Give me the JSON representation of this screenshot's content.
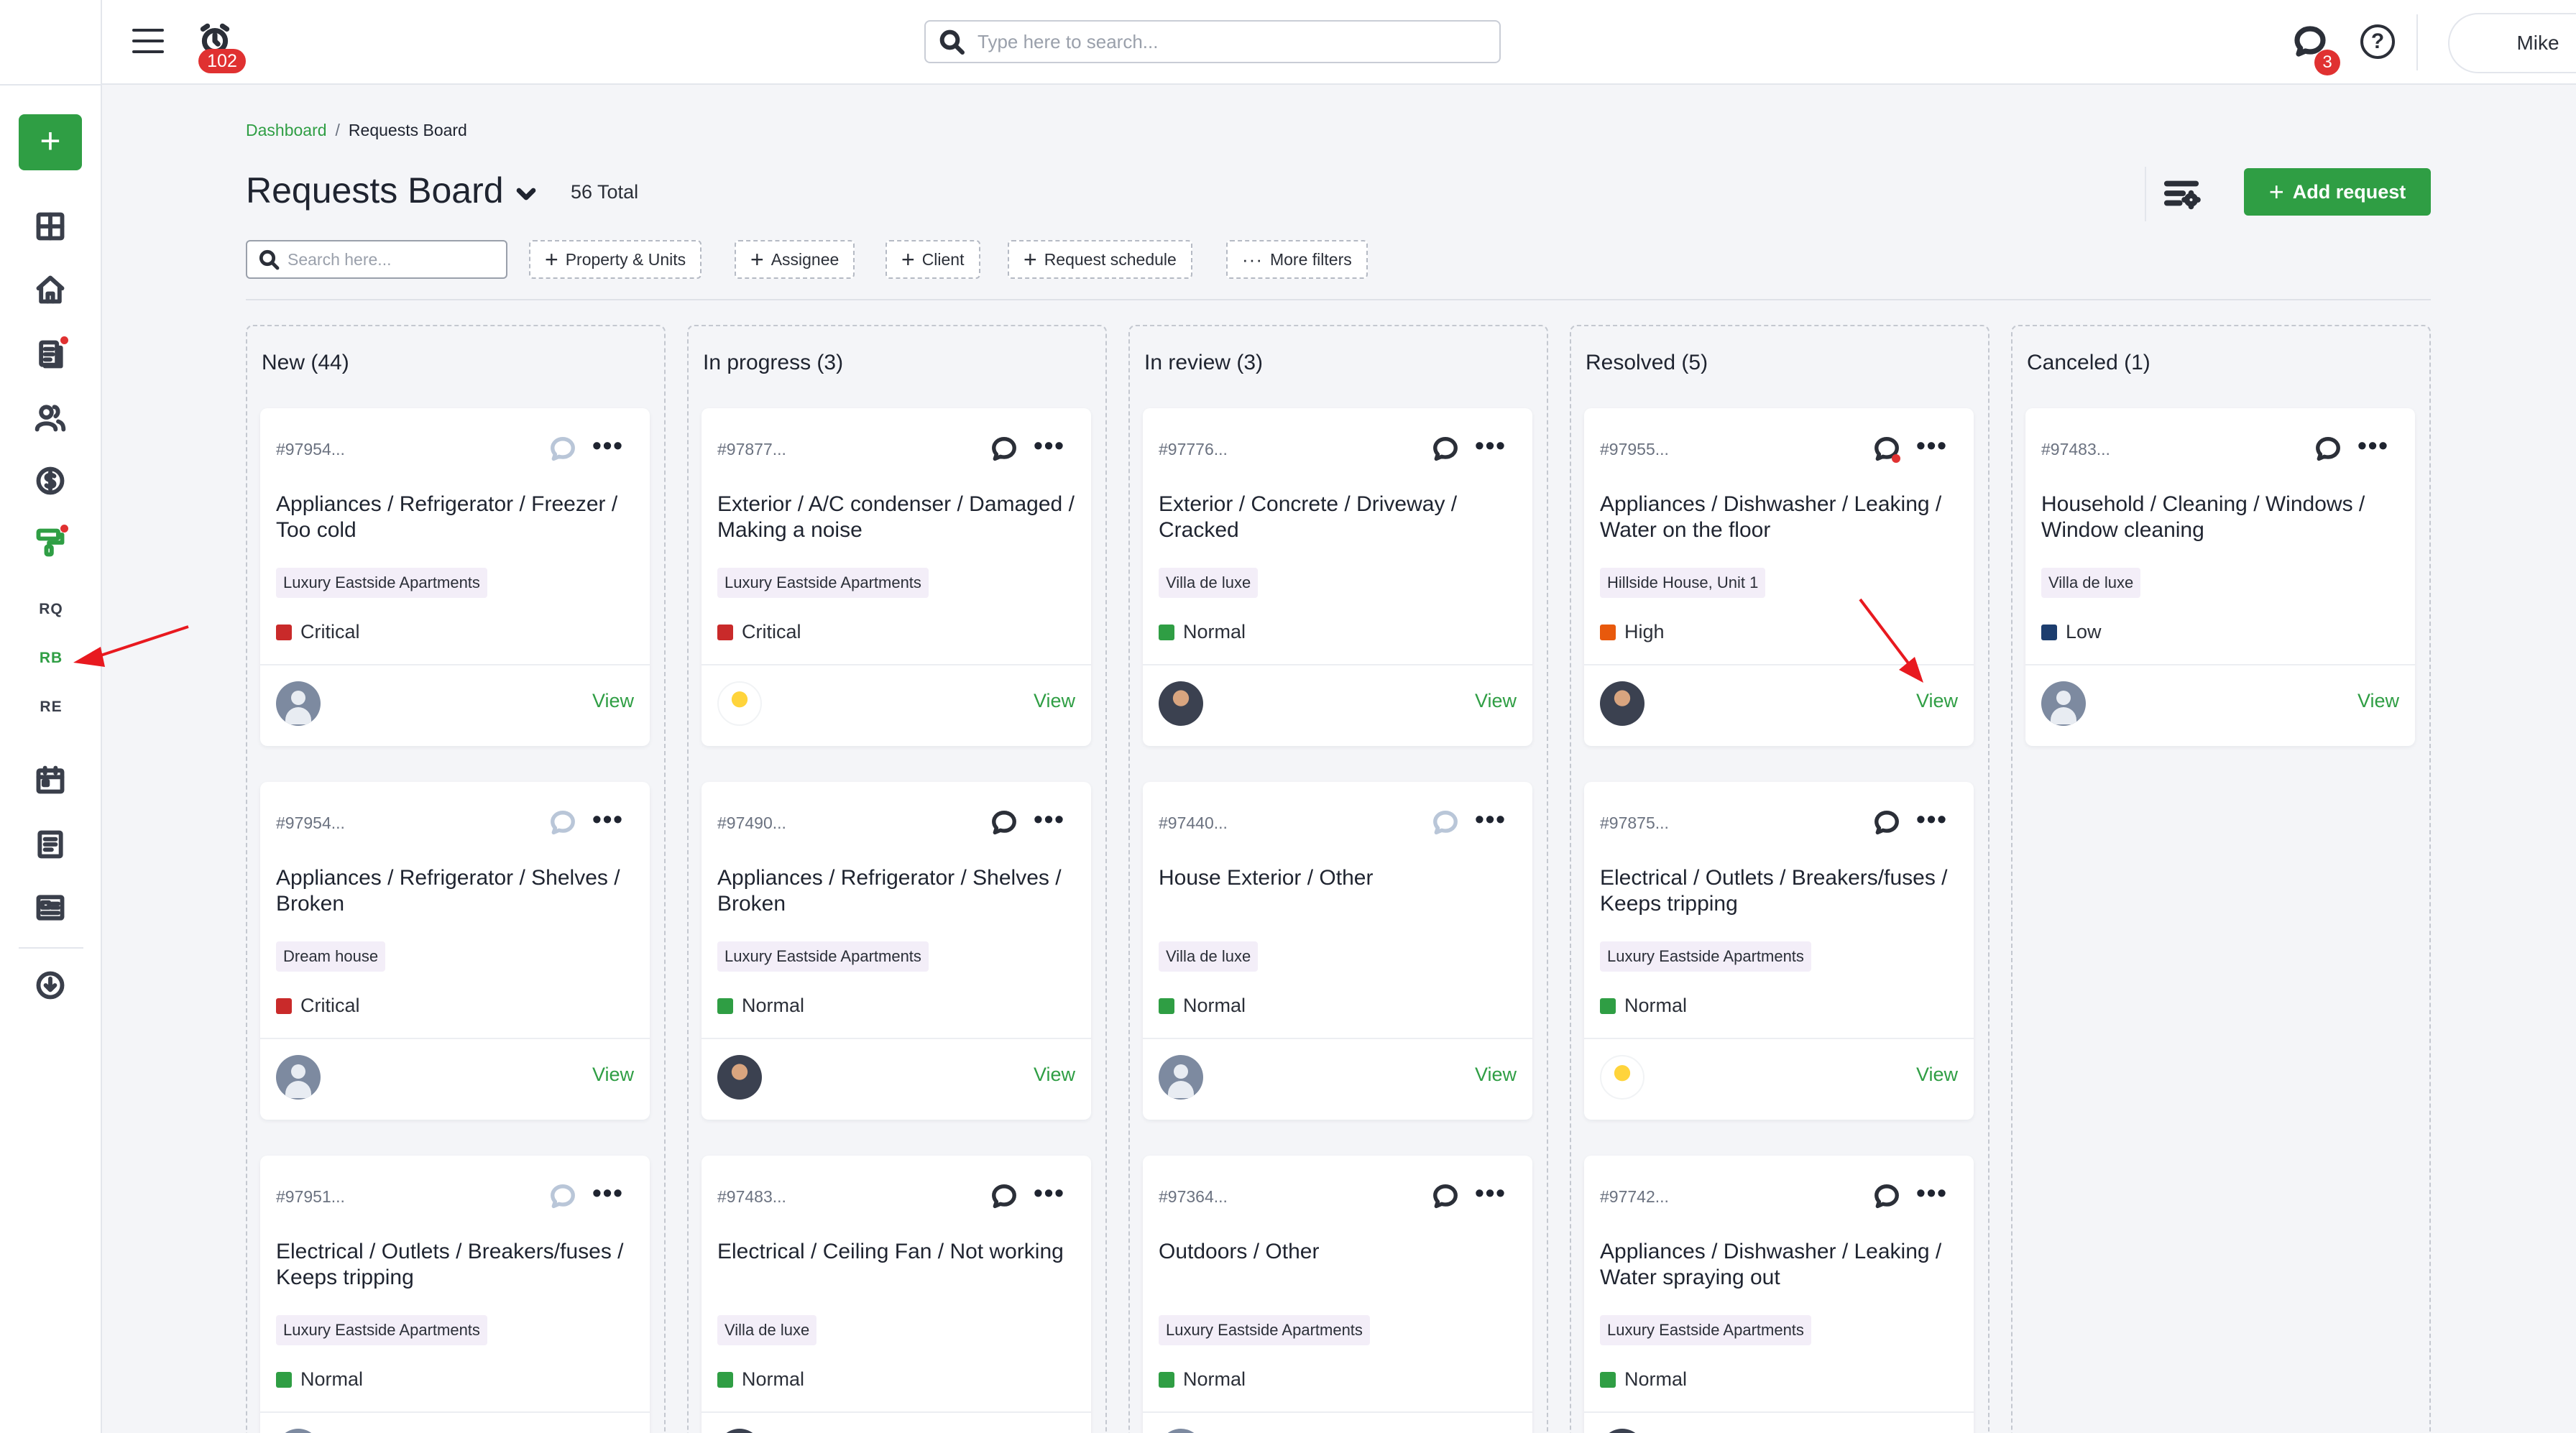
{
  "topbar": {
    "notifications_badge": "102",
    "search_placeholder": "Type here to search...",
    "messages_badge": "3",
    "user_name": "Mike"
  },
  "sidebar": {
    "add_label": "+",
    "sub_items": [
      "RQ",
      "RB",
      "RE"
    ],
    "active_sub_item": "RB"
  },
  "breadcrumb": {
    "home": "Dashboard",
    "separator": "/",
    "current": "Requests Board"
  },
  "page": {
    "title": "Requests Board",
    "total": "56 Total",
    "add_request_label": "Add request",
    "add_request_icon": "+"
  },
  "filters": {
    "search_placeholder": "Search here...",
    "chips": [
      "Property & Units",
      "Assignee",
      "Client",
      "Request schedule"
    ],
    "more_filters": "More filters",
    "chip_icon": "+",
    "more_icon": "···"
  },
  "columns": [
    {
      "title": "New (44)",
      "cards": [
        {
          "id": "#97954...",
          "title": "Appliances / Refrigerator / Freezer / Too cold",
          "property": "Luxury Eastside Apartments",
          "priority": "Critical",
          "priority_color": "#c92a2a",
          "chat": "off",
          "avatar": "default",
          "action": "View"
        },
        {
          "id": "#97954...",
          "title": "Appliances / Refrigerator / Shelves / Broken",
          "property": "Dream house",
          "priority": "Critical",
          "priority_color": "#c92a2a",
          "chat": "off",
          "avatar": "default",
          "action": "View"
        },
        {
          "id": "#97951...",
          "title": "Electrical / Outlets / Breakers/fuses / Keeps tripping",
          "property": "Luxury Eastside Apartments",
          "priority": "Normal",
          "priority_color": "#2f9e44",
          "chat": "off",
          "avatar": "default",
          "action": "View"
        }
      ]
    },
    {
      "title": "In progress (3)",
      "cards": [
        {
          "id": "#97877...",
          "title": "Exterior / A/C condenser / Damaged / Making a noise",
          "property": "Luxury Eastside Apartments",
          "priority": "Critical",
          "priority_color": "#c92a2a",
          "chat": "on",
          "avatar": "cartoon",
          "action": "View"
        },
        {
          "id": "#97490...",
          "title": "Appliances / Refrigerator / Shelves / Broken",
          "property": "Luxury Eastside Apartments",
          "priority": "Normal",
          "priority_color": "#2f9e44",
          "chat": "on",
          "avatar": "photo",
          "action": "View"
        },
        {
          "id": "#97483...",
          "title": "Electrical / Ceiling Fan / Not working",
          "property": "Villa de luxe",
          "priority": "Normal",
          "priority_color": "#2f9e44",
          "chat": "on",
          "avatar": "photo",
          "action": "View"
        }
      ]
    },
    {
      "title": "In review (3)",
      "cards": [
        {
          "id": "#97776...",
          "title": "Exterior / Concrete / Driveway / Cracked",
          "property": "Villa de luxe",
          "priority": "Normal",
          "priority_color": "#2f9e44",
          "chat": "on",
          "avatar": "photo",
          "action": "View"
        },
        {
          "id": "#97440...",
          "title": "House Exterior / Other",
          "property": "Villa de luxe",
          "priority": "Normal",
          "priority_color": "#2f9e44",
          "chat": "off",
          "avatar": "default",
          "action": "View"
        },
        {
          "id": "#97364...",
          "title": "Outdoors / Other",
          "property": "Luxury Eastside Apartments",
          "priority": "Normal",
          "priority_color": "#2f9e44",
          "chat": "on",
          "avatar": "default",
          "action": "View"
        }
      ]
    },
    {
      "title": "Resolved (5)",
      "cards": [
        {
          "id": "#97955...",
          "title": "Appliances / Dishwasher / Leaking / Water on the floor",
          "property": "Hillside House, Unit 1",
          "priority": "High",
          "priority_color": "#e8590c",
          "chat": "on-dot",
          "avatar": "photo",
          "action": "View"
        },
        {
          "id": "#97875...",
          "title": "Electrical / Outlets / Breakers/fuses / Keeps tripping",
          "property": "Luxury Eastside Apartments",
          "priority": "Normal",
          "priority_color": "#2f9e44",
          "chat": "on",
          "avatar": "cartoon",
          "action": "View"
        },
        {
          "id": "#97742...",
          "title": "Appliances / Dishwasher / Leaking / Water spraying out",
          "property": "Luxury Eastside Apartments",
          "priority": "Normal",
          "priority_color": "#2f9e44",
          "chat": "on",
          "avatar": "photo",
          "action": "View"
        }
      ]
    },
    {
      "title": "Canceled (1)",
      "cards": [
        {
          "id": "#97483...",
          "title": "Household / Cleaning / Windows / Window cleaning",
          "property": "Villa de luxe",
          "priority": "Low",
          "priority_color": "#1c3d6e",
          "chat": "on",
          "avatar": "default",
          "action": "View"
        }
      ]
    }
  ],
  "colors": {
    "accent": "#2f9e44",
    "badge": "#e03131",
    "annotation_arrow": "#e8191f"
  }
}
